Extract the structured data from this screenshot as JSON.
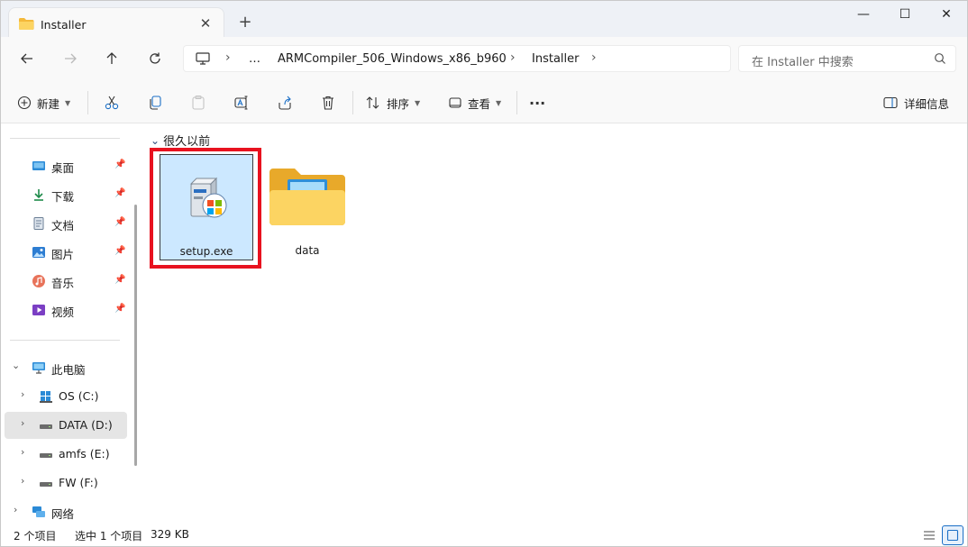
{
  "window": {
    "tab_title": "Installer",
    "tab_close": "✕",
    "tab_add": "+",
    "minimize": "—",
    "maximize": "☐",
    "close": "✕"
  },
  "address": {
    "crumbs": [
      "…",
      "ARMCompiler_506_Windows_x86_b960",
      "Installer"
    ],
    "search_placeholder": "在 Installer 中搜索"
  },
  "toolbar": {
    "new_label": "新建",
    "sort_label": "排序",
    "view_label": "查看",
    "more_label": "···",
    "details_label": "详细信息"
  },
  "sidebar": {
    "quick_access": [
      {
        "label": "桌面",
        "icon": "desktop-icon"
      },
      {
        "label": "下载",
        "icon": "download-icon"
      },
      {
        "label": "文档",
        "icon": "document-icon"
      },
      {
        "label": "图片",
        "icon": "picture-icon"
      },
      {
        "label": "音乐",
        "icon": "music-icon"
      },
      {
        "label": "视频",
        "icon": "video-icon"
      }
    ],
    "this_pc": "此电脑",
    "drives": [
      {
        "label": "OS (C:)",
        "icon": "windows-drive-icon"
      },
      {
        "label": "DATA (D:)",
        "icon": "drive-icon",
        "selected": true
      },
      {
        "label": "amfs (E:)",
        "icon": "drive-icon"
      },
      {
        "label": "FW (F:)",
        "icon": "drive-icon"
      }
    ],
    "network": "网络"
  },
  "content": {
    "group_label": "很久以前",
    "items": [
      {
        "name": "setup.exe",
        "type": "installer",
        "selected": true
      },
      {
        "name": "data",
        "type": "folder",
        "selected": false
      }
    ]
  },
  "status": {
    "count": "2 个项目",
    "selected": "选中 1 个项目",
    "size": "329 KB"
  },
  "colors": {
    "accent": "#1b6fc6",
    "highlight": "#e8121f",
    "selection": "#cce8ff",
    "folder": "#f7c64a"
  }
}
